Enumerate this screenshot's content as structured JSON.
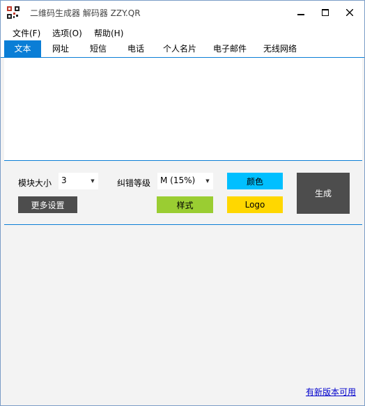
{
  "app": {
    "title": "二维码生成器 解码器 ZZY.QR"
  },
  "window_controls": {
    "minimize": "▁",
    "maximize": "☐",
    "close": "✕"
  },
  "menu": [
    "文件(F)",
    "选项(O)",
    "帮助(H)"
  ],
  "tabs": [
    "文本",
    "网址",
    "短信",
    "电话",
    "个人名片",
    "电子邮件",
    "无线网络"
  ],
  "active_tab": "文本",
  "text_input": {
    "value": ""
  },
  "settings": {
    "module_size_label": "模块大小",
    "module_size_value": "3",
    "error_level_label": "纠错等级",
    "error_level_value": "M (15%)",
    "more_settings": "更多设置",
    "color_button": "颜色",
    "style_button": "样式",
    "logo_button": "Logo",
    "generate_button": "生成"
  },
  "colors": {
    "accent": "#0a7ed6",
    "color_button": "#00bfff",
    "style_button": "#9acd32",
    "logo_button": "#ffd700",
    "dark_button": "#4d4d4d"
  },
  "icons": {
    "dropdown_arrow": "arrow-down-icon"
  },
  "footer": {
    "update_link": "有新版本可用"
  }
}
